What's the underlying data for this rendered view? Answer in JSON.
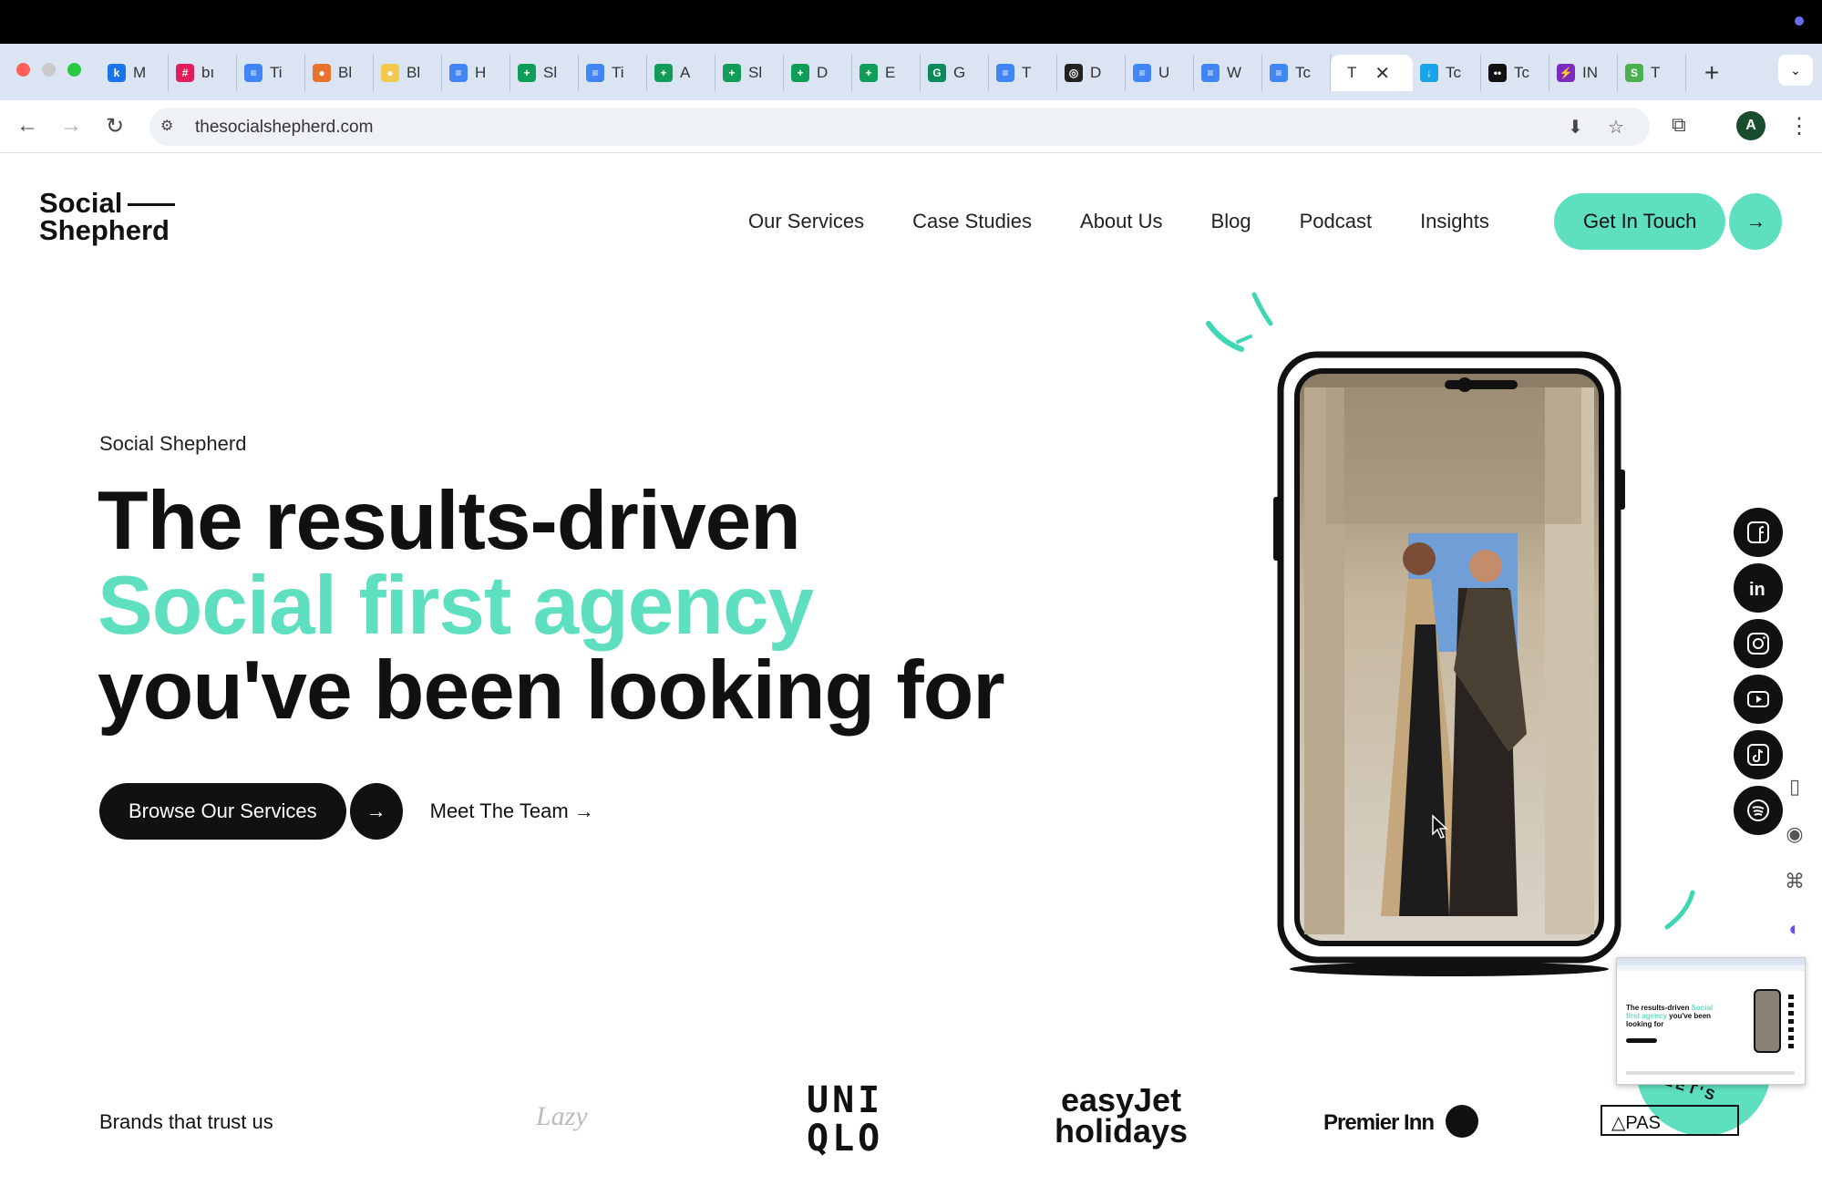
{
  "browser": {
    "tabs": [
      {
        "icon_text": "k",
        "label": "M",
        "color": "#1a73e8"
      },
      {
        "icon_text": "#",
        "label": "bı",
        "color": "#e01e5a"
      },
      {
        "icon_text": "≡",
        "label": "Ti",
        "color": "#4285f4"
      },
      {
        "icon_text": "●",
        "label": "Bl",
        "color": "#e8712c"
      },
      {
        "icon_text": "●",
        "label": "Bl",
        "color": "#f2c94c"
      },
      {
        "icon_text": "≡",
        "label": "H",
        "color": "#4285f4"
      },
      {
        "icon_text": "+",
        "label": "Sl",
        "color": "#0f9d58"
      },
      {
        "icon_text": "≡",
        "label": "Ti",
        "color": "#4285f4"
      },
      {
        "icon_text": "+",
        "label": "A",
        "color": "#0f9d58"
      },
      {
        "icon_text": "+",
        "label": "Sl",
        "color": "#0f9d58"
      },
      {
        "icon_text": "+",
        "label": "D",
        "color": "#0f9d58"
      },
      {
        "icon_text": "+",
        "label": "E",
        "color": "#0f9d58"
      },
      {
        "icon_text": "G",
        "label": "G",
        "color": "#0b8a5b"
      },
      {
        "icon_text": "≡",
        "label": "T",
        "color": "#4285f4"
      },
      {
        "icon_text": "◎",
        "label": "D",
        "color": "#222222"
      },
      {
        "icon_text": "≡",
        "label": "U",
        "color": "#4285f4"
      },
      {
        "icon_text": "≡",
        "label": "W",
        "color": "#4285f4"
      },
      {
        "icon_text": "≡",
        "label": "Tc",
        "color": "#4285f4"
      }
    ],
    "active_tab_label": "T",
    "after_tabs": [
      {
        "icon_text": "↓",
        "label": "Tc",
        "color": "#1aa3e8"
      },
      {
        "icon_text": "••",
        "label": "Tc",
        "color": "#111111"
      },
      {
        "icon_text": "⚡",
        "label": "IN",
        "color": "#7b2cbf"
      },
      {
        "icon_text": "S",
        "label": "T",
        "color": "#4caf50"
      }
    ],
    "url": "thesocialshepherd.com",
    "profile_initial": "A"
  },
  "site": {
    "logo_line1": "Social",
    "logo_line2": "Shepherd",
    "nav": [
      "Our Services",
      "Case Studies",
      "About Us",
      "Blog",
      "Podcast",
      "Insights"
    ],
    "cta_label": "Get In Touch",
    "accent_color": "#5ee0c0"
  },
  "hero": {
    "eyebrow": "Social Shepherd",
    "headline_part1": "The results-driven ",
    "headline_teal": "Social first agency",
    "headline_part2": " you've been looking for",
    "primary_button": "Browse Our Services",
    "secondary_link": "Meet The Team →"
  },
  "social_icons": [
    "facebook-icon",
    "linkedin-icon",
    "instagram-icon",
    "youtube-icon",
    "tiktok-icon",
    "spotify-icon"
  ],
  "thumbnail": {
    "headline_part1": "The results-driven ",
    "headline_teal": "Social first agency",
    "headline_part2": " you've been looking for"
  },
  "badge_text": "LET'S",
  "brands": {
    "label": "Brands that trust us",
    "items": [
      "Lazy",
      "UNI QLO",
      "easyJet holidays",
      "Premier Inn",
      "PAS"
    ]
  }
}
